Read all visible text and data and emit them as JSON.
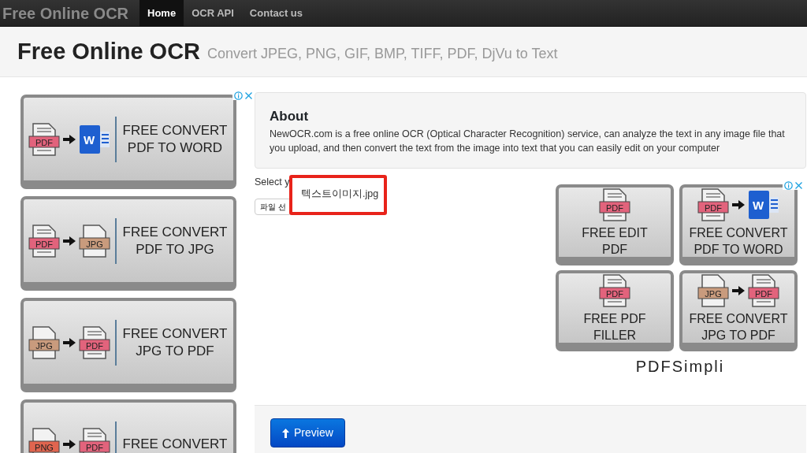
{
  "navbar": {
    "brand": "Free Online OCR",
    "links": [
      {
        "label": "Home",
        "selected": true
      },
      {
        "label": "OCR API",
        "selected": false
      },
      {
        "label": "Contact us",
        "selected": false
      }
    ]
  },
  "header": {
    "title": "Free Online OCR",
    "subtitle": "Convert JPEG, PNG, GIF, BMP, TIFF, PDF, DjVu to Text"
  },
  "left_ad": {
    "tiles": [
      {
        "icons": [
          {
            "kind": "pdf",
            "label": "PDF"
          },
          {
            "kind": "word",
            "label": "W"
          }
        ],
        "lines": [
          "FREE CONVERT",
          "PDF TO WORD"
        ]
      },
      {
        "icons": [
          {
            "kind": "pdf",
            "label": "PDF"
          },
          {
            "kind": "jpg",
            "label": "JPG"
          }
        ],
        "lines": [
          "FREE CONVERT",
          "PDF TO JPG"
        ]
      },
      {
        "icons": [
          {
            "kind": "jpg",
            "label": "JPG"
          },
          {
            "kind": "pdf",
            "label": "PDF"
          }
        ],
        "lines": [
          "FREE CONVERT",
          "JPG TO PDF"
        ]
      },
      {
        "icons": [
          {
            "kind": "png",
            "label": "PNG"
          },
          {
            "kind": "pdf",
            "label": "PDF"
          }
        ],
        "lines": [
          "FREE CONVERT"
        ]
      }
    ]
  },
  "about": {
    "title": "About",
    "text": "NewOCR.com is a free online OCR (Optical Character Recognition) service, can analyze the text in any image file that you upload, and then convert the text from the image into text that you can easily edit on your computer"
  },
  "upload": {
    "label": "Select y",
    "button": "파일 선",
    "popup": "텍스트이미지.jpg"
  },
  "right_ad": {
    "tiles": [
      {
        "icons": [
          {
            "kind": "pdf",
            "label": "PDF"
          }
        ],
        "lines": [
          "FREE EDIT",
          "PDF"
        ]
      },
      {
        "icons": [
          {
            "kind": "pdf",
            "label": "PDF"
          },
          {
            "kind": "word",
            "label": "W"
          }
        ],
        "lines": [
          "FREE CONVERT",
          "PDF TO WORD"
        ]
      },
      {
        "icons": [
          {
            "kind": "pdf",
            "label": "PDF"
          }
        ],
        "lines": [
          "FREE PDF",
          "FILLER"
        ]
      },
      {
        "icons": [
          {
            "kind": "jpg",
            "label": "JPG"
          },
          {
            "kind": "pdf",
            "label": "PDF"
          }
        ],
        "lines": [
          "FREE CONVERT",
          "JPG TO PDF"
        ]
      }
    ],
    "brand": "PDFSimpli"
  },
  "preview_button": "Preview"
}
